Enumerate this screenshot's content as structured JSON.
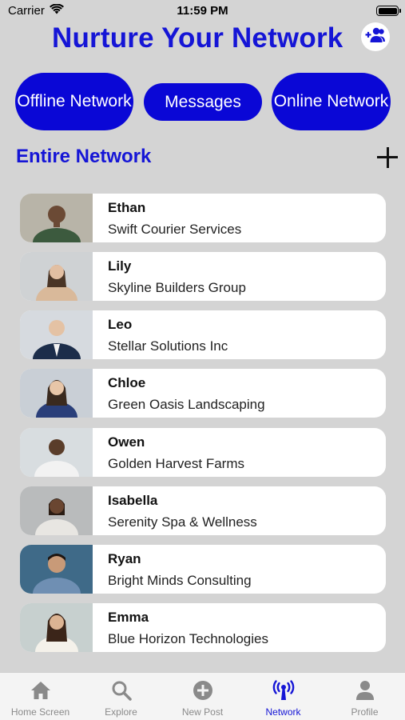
{
  "status_bar": {
    "carrier": "Carrier",
    "time": "11:59 PM"
  },
  "header": {
    "title": "Nurture Your Network",
    "add_icon": "person-add-icon"
  },
  "tabs_top": {
    "offline": "Offline Network",
    "messages": "Messages",
    "online": "Online Network"
  },
  "section": {
    "title": "Entire Network",
    "add_icon": "plus-icon"
  },
  "contacts": [
    {
      "name": "Ethan",
      "company": "Swift Courier Services",
      "shirt": "#3c5a3e",
      "bg": "#b8b4a8"
    },
    {
      "name": "Lily",
      "company": "Skyline Builders Group",
      "shirt": "#d9b99a",
      "bg": "#cfd2d4"
    },
    {
      "name": "Leo",
      "company": "Stellar Solutions Inc",
      "shirt": "#1c2d4a",
      "bg": "#d6dadf"
    },
    {
      "name": "Chloe",
      "company": "Green Oasis Landscaping",
      "shirt": "#2a3f7a",
      "bg": "#c9cfd6"
    },
    {
      "name": "Owen",
      "company": "Golden Harvest Farms",
      "shirt": "#f2f2f2",
      "bg": "#d8dde0"
    },
    {
      "name": "Isabella",
      "company": "Serenity Spa & Wellness",
      "shirt": "#e8e6e2",
      "bg": "#b9bbbc"
    },
    {
      "name": "Ryan",
      "company": "Bright Minds Consulting",
      "shirt": "#6f8fb3",
      "bg": "#3f6a88"
    },
    {
      "name": "Emma",
      "company": "Blue Horizon Technologies",
      "shirt": "#f4f1ea",
      "bg": "#c7d0cf"
    }
  ],
  "tab_bar": [
    {
      "label": "Home Screen",
      "icon": "house-icon",
      "active": false
    },
    {
      "label": "Explore",
      "icon": "magnifier-icon",
      "active": false
    },
    {
      "label": "New Post",
      "icon": "plus-circle-icon",
      "active": false
    },
    {
      "label": "Network",
      "icon": "antenna-icon",
      "active": true
    },
    {
      "label": "Profile",
      "icon": "person-icon",
      "active": false
    }
  ],
  "colors": {
    "accent": "#1515d6",
    "pill": "#0a07d6",
    "background": "#d4d4d4"
  }
}
